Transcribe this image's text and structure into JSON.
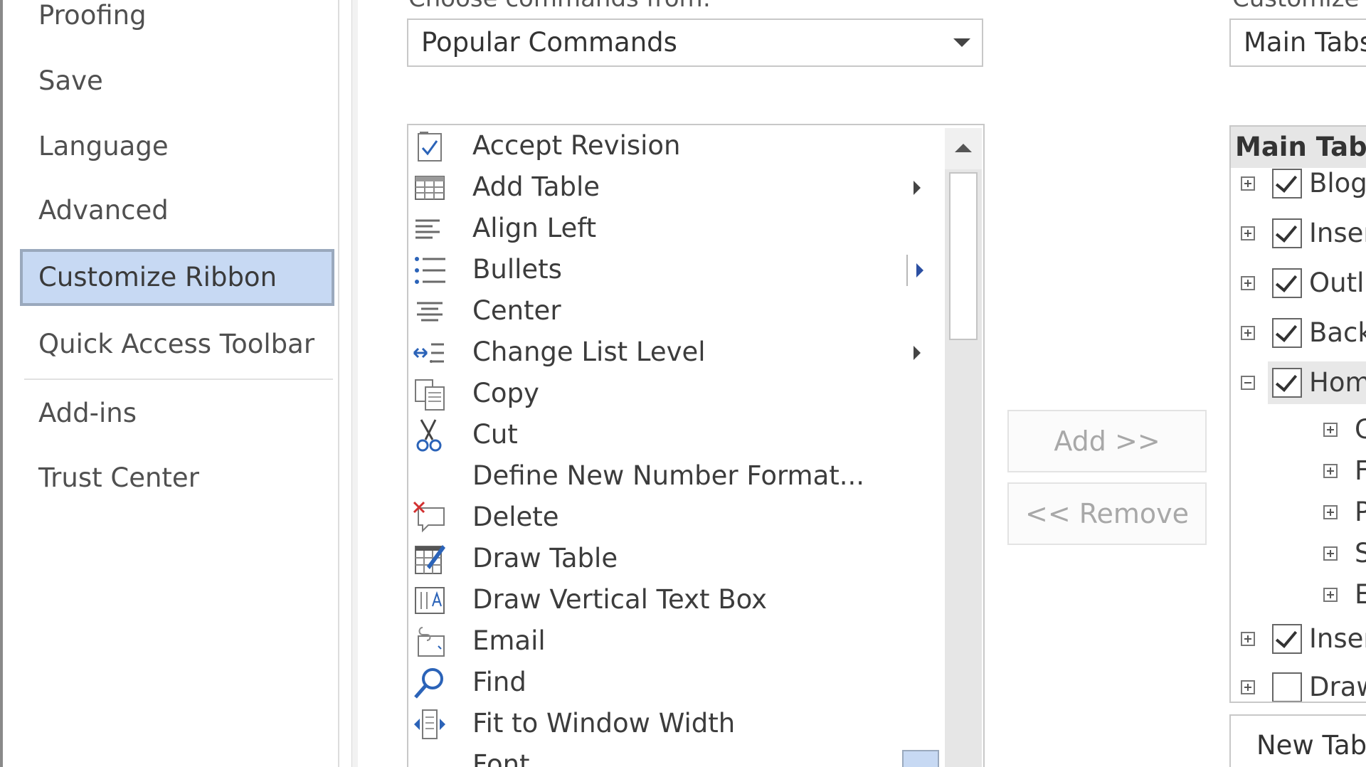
{
  "nav": {
    "items": [
      {
        "label": "Proofing"
      },
      {
        "label": "Save"
      },
      {
        "label": "Language"
      },
      {
        "label": "Advanced"
      },
      {
        "label": "Customize Ribbon",
        "selected": true
      },
      {
        "label": "Quick Access Toolbar"
      },
      {
        "label": "Add-ins"
      },
      {
        "label": "Trust Center"
      }
    ]
  },
  "commands_panel": {
    "label": "Choose commands from:",
    "dropdown_value": "Popular Commands",
    "items": [
      {
        "label": "Accept Revision",
        "icon": "accept-revision-icon"
      },
      {
        "label": "Add Table",
        "icon": "table-icon",
        "submenu": true
      },
      {
        "label": "Align Left",
        "icon": "align-left-icon"
      },
      {
        "label": "Bullets",
        "icon": "bullets-icon",
        "submenu": true
      },
      {
        "label": "Center",
        "icon": "align-center-icon"
      },
      {
        "label": "Change List Level",
        "icon": "list-level-icon",
        "submenu": true
      },
      {
        "label": "Copy",
        "icon": "copy-icon"
      },
      {
        "label": "Cut",
        "icon": "scissors-icon"
      },
      {
        "label": "Define New Number Format...",
        "icon": ""
      },
      {
        "label": "Delete",
        "icon": "delete-comment-icon"
      },
      {
        "label": "Draw Table",
        "icon": "draw-table-icon"
      },
      {
        "label": "Draw Vertical Text Box",
        "icon": "vertical-text-box-icon"
      },
      {
        "label": "Email",
        "icon": "email-icon"
      },
      {
        "label": "Find",
        "icon": "magnifier-icon"
      },
      {
        "label": "Fit to Window Width",
        "icon": "fit-width-icon"
      },
      {
        "label": "Font",
        "icon": ""
      }
    ]
  },
  "buttons": {
    "add_label": "Add >>",
    "remove_label": "<< Remove"
  },
  "ribbon_panel": {
    "label": "Customize the Ribbon:",
    "dropdown_value": "Main Tabs",
    "tree_header": "Main Tabs",
    "tabs": [
      {
        "label": "Blog Post",
        "checked": true,
        "expanded": false
      },
      {
        "label": "Insert (Blog Post)",
        "checked": true,
        "expanded": false
      },
      {
        "label": "Outlining",
        "checked": true,
        "expanded": false
      },
      {
        "label": "Background Removal",
        "checked": true,
        "expanded": false
      },
      {
        "label": "Home",
        "checked": true,
        "expanded": true
      },
      {
        "label": "Insert",
        "checked": true,
        "expanded": false
      },
      {
        "label": "Draw",
        "checked": false,
        "expanded": false
      }
    ],
    "home_groups": [
      {
        "label": "Clipboard"
      },
      {
        "label": "Font"
      },
      {
        "label": "Paragraph"
      },
      {
        "label": "Styles"
      },
      {
        "label": "Editing"
      }
    ],
    "new_tab_label": "New Tab"
  }
}
